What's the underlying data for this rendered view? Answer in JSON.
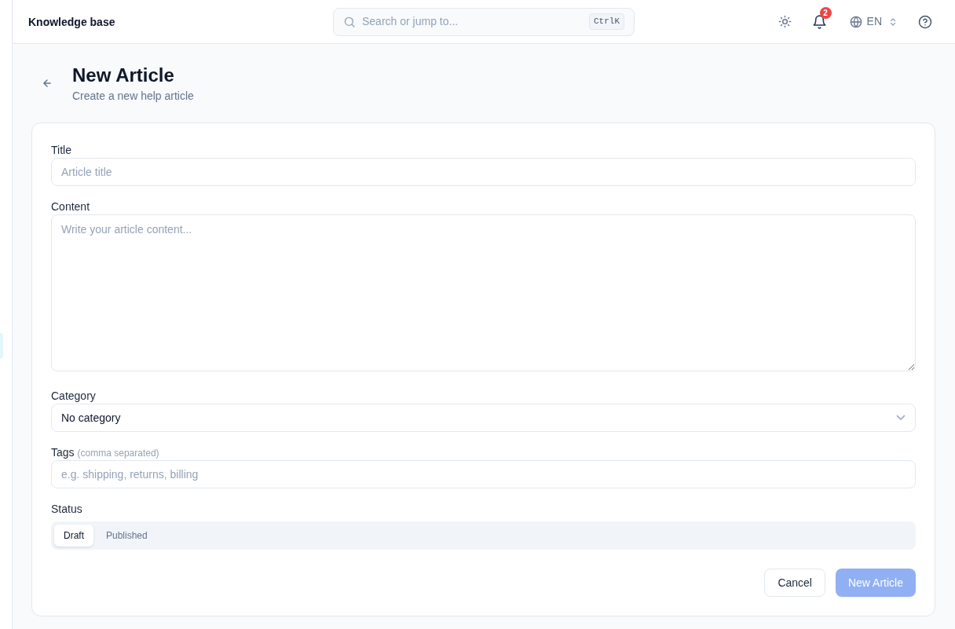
{
  "header": {
    "title": "Knowledge base",
    "search": {
      "placeholder": "Search or jump to...",
      "shortcut": "CtrlK"
    },
    "notifications": {
      "count": "2"
    },
    "language": "EN"
  },
  "page": {
    "title": "New Article",
    "subtitle": "Create a new help article"
  },
  "form": {
    "fields": [
      {
        "kind": "text",
        "label": "Title",
        "placeholder": "Article title"
      },
      {
        "kind": "textarea",
        "label": "Content",
        "placeholder": "Write your article content..."
      },
      {
        "kind": "select",
        "label": "Category",
        "value": "No category"
      },
      {
        "kind": "text",
        "label": "Tags",
        "hint": "(comma separated)",
        "placeholder": "e.g. shipping, returns, billing"
      },
      {
        "kind": "segmented",
        "label": "Status",
        "options": [
          {
            "label": "Draft",
            "selected": true
          },
          {
            "label": "Published",
            "selected": false
          }
        ]
      }
    ],
    "buttons": [
      {
        "kind": "secondary",
        "label": "Cancel",
        "disabled": false
      },
      {
        "kind": "primary",
        "label": "New Article",
        "disabled": true
      }
    ]
  }
}
